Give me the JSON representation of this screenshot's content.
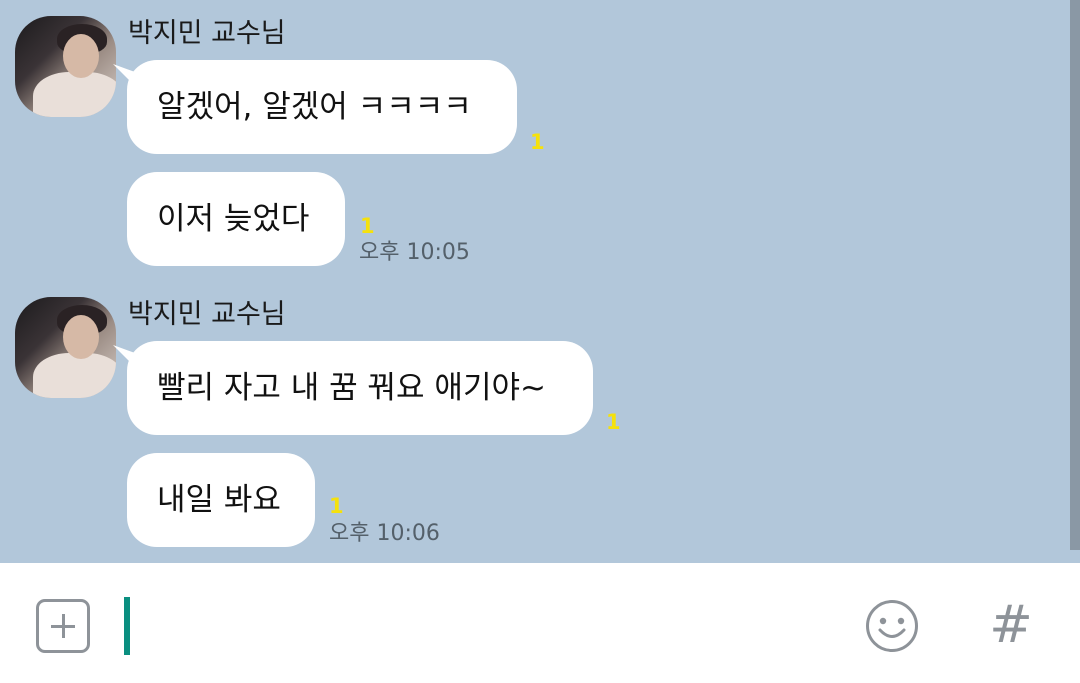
{
  "messages": [
    {
      "sender": "박지민 교수님",
      "bubbles": [
        {
          "text": "알겠어, 알겠어 ㅋㅋㅋㅋ",
          "unread": "1",
          "time": ""
        },
        {
          "text": "이저 늦었다",
          "unread": "1",
          "time": "오후 10:05"
        }
      ]
    },
    {
      "sender": "박지민 교수님",
      "bubbles": [
        {
          "text": "빨리 자고 내 꿈 꿔요 애기야~",
          "unread": "1",
          "time": ""
        },
        {
          "text": "내일 봐요",
          "unread": "1",
          "time": "오후 10:06"
        }
      ]
    }
  ],
  "input": {
    "value": "",
    "placeholder": "",
    "hash_label": "#"
  },
  "icons": {
    "add": "plus-square-icon",
    "emoji": "smiley-icon",
    "hashtag": "hash-icon"
  },
  "colors": {
    "chat_background": "#b2c7da",
    "bubble": "#ffffff",
    "unread": "#f5e10c",
    "caret": "#0a8f80"
  }
}
